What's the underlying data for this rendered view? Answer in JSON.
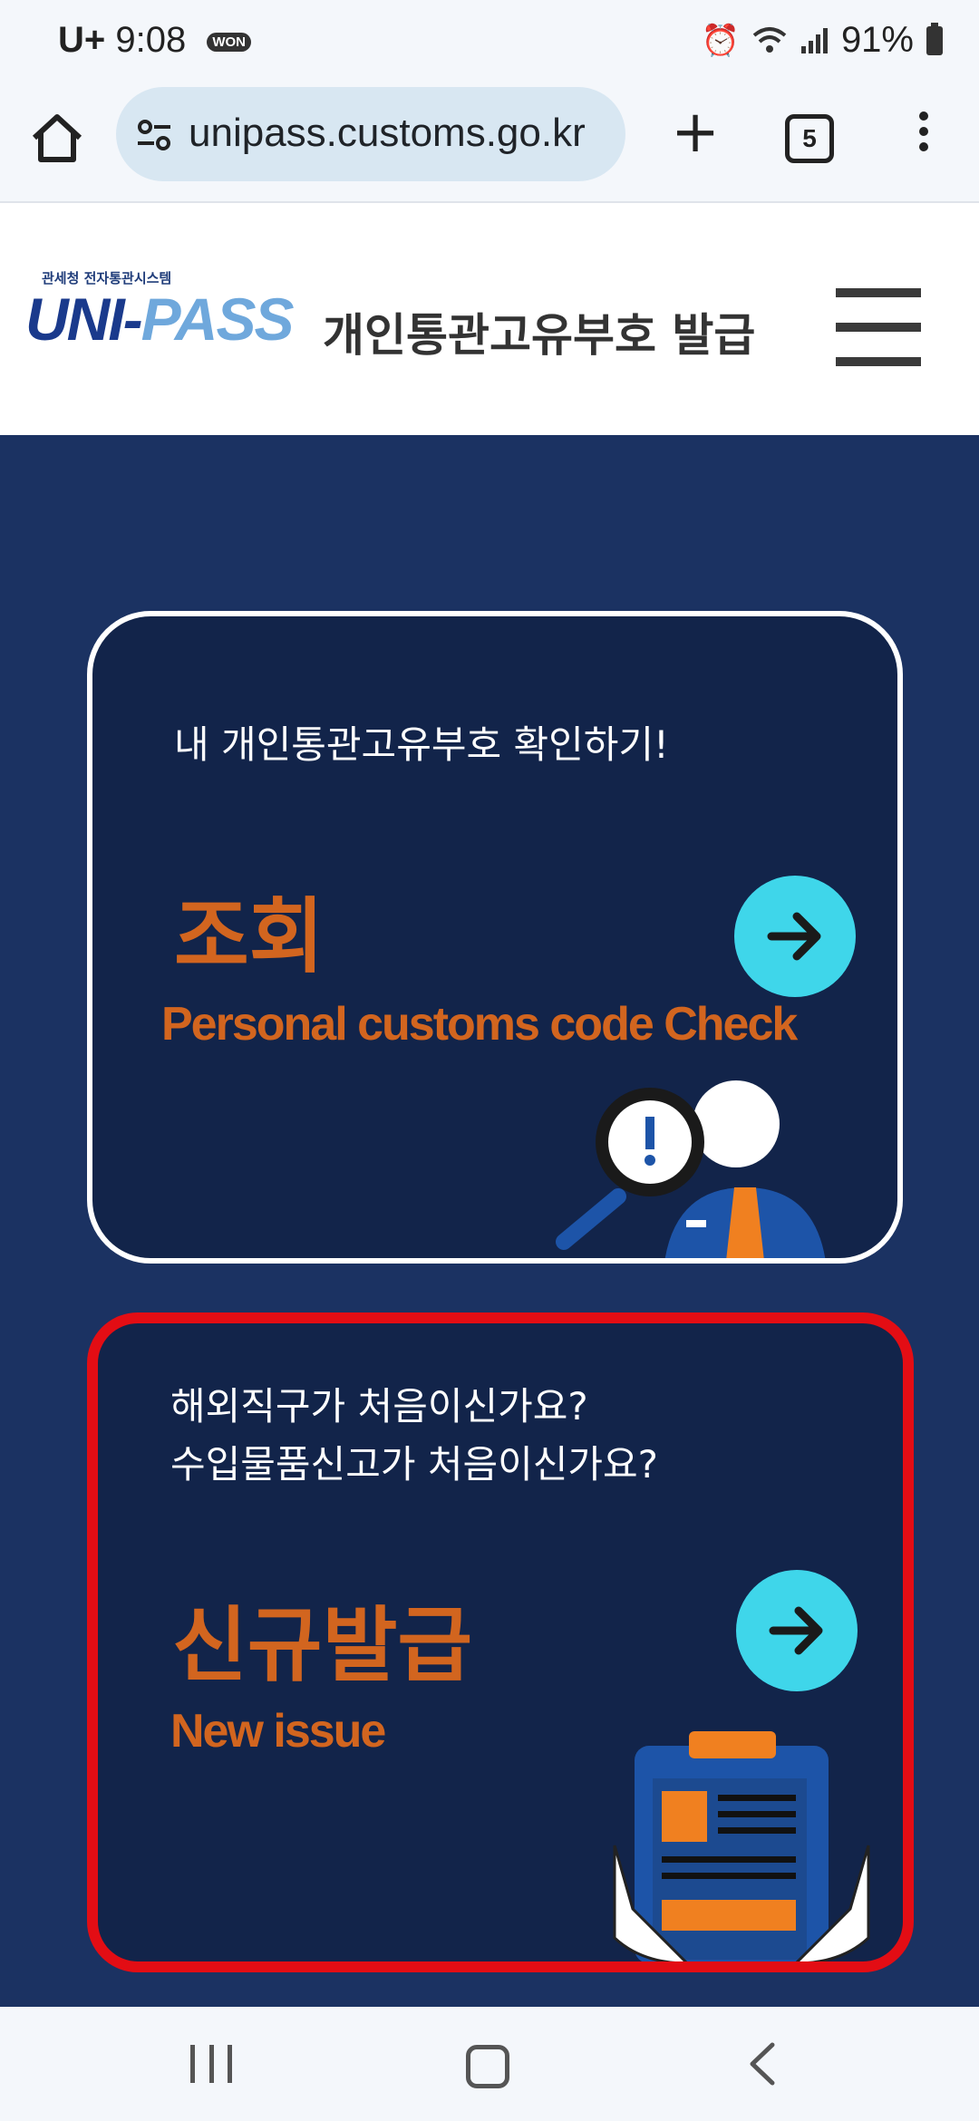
{
  "status_bar": {
    "carrier": "U+",
    "time": "9:08",
    "badge": "WON",
    "battery": "91%"
  },
  "browser": {
    "url": "unipass.customs.go.kr",
    "tab_count": "5"
  },
  "site": {
    "logo_top": "관세청 전자통관시스템",
    "logo_main_a": "UNI-",
    "logo_main_b": "PASS",
    "title": "개인통관고유부호  발급"
  },
  "cards": [
    {
      "subtitle_1": "내 개인통관고유부호 확인하기!",
      "title": "조회",
      "english": "Personal customs code Check"
    },
    {
      "subtitle_1": "해외직구가 처음이신가요?",
      "subtitle_2": "수입물품신고가 처음이신가요?",
      "title": "신규발급",
      "english": "New issue"
    }
  ],
  "colors": {
    "page_bg": "#1b3262",
    "card_bg": "#12244a",
    "accent_orange": "#d2651f",
    "arrow_cyan": "#3fd6ea",
    "highlight_red": "#e30d14"
  }
}
